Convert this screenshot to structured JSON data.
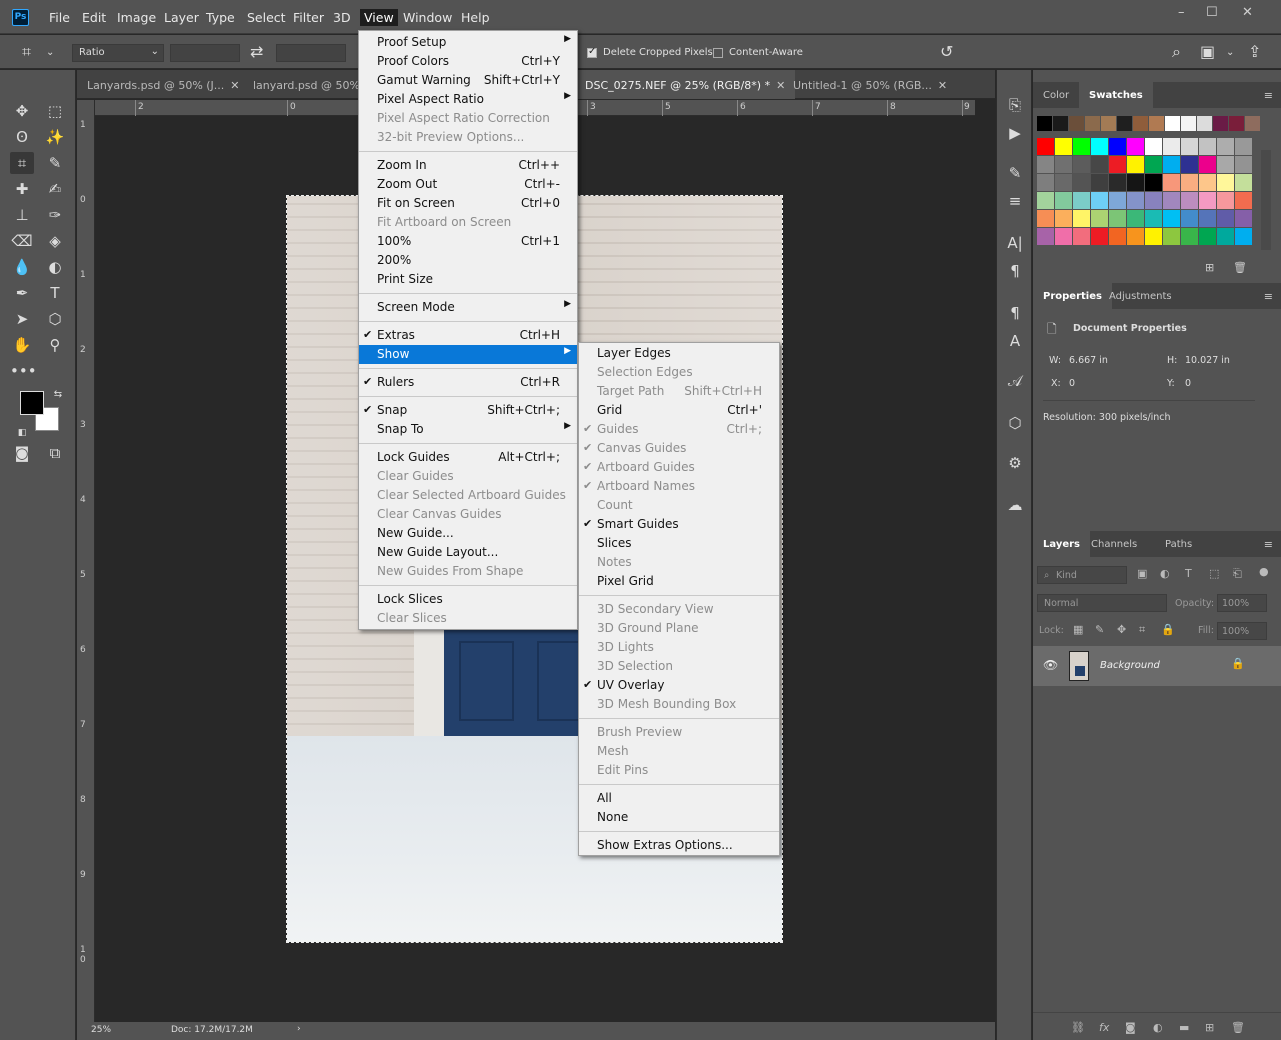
{
  "app": {
    "logo": "Ps",
    "menus": [
      "File",
      "Edit",
      "Image",
      "Layer",
      "Type",
      "Select",
      "Filter",
      "3D",
      "View",
      "Window",
      "Help"
    ],
    "window_controls": [
      "–",
      "☐",
      "✕"
    ]
  },
  "options": {
    "ratio_select": "Ratio",
    "delete_cropped": "Delete Cropped Pixels",
    "content_aware": "Content-Aware"
  },
  "tabs": [
    {
      "label": "Lanyards.psd @ 50% (J..."
    },
    {
      "label": "lanyard.psd @ 50%"
    },
    {
      "label": "DSC_0275.NEF @ 25% (RGB/8*) *"
    },
    {
      "label": "Untitled-1 @ 50% (RGB..."
    }
  ],
  "ruler_h": [
    "2",
    "0",
    "3",
    "4",
    "5",
    "6",
    "7",
    "8",
    "9"
  ],
  "ruler_v": [
    "1",
    "0",
    "1",
    "2",
    "3",
    "4",
    "5",
    "6",
    "7",
    "8",
    "9",
    "1",
    "0"
  ],
  "status": {
    "zoom": "25%",
    "doc": "Doc: 17.2M/17.2M"
  },
  "view_menu": [
    {
      "label": "Proof Setup",
      "shortcut": "",
      "arrow": true
    },
    {
      "label": "Proof Colors",
      "shortcut": "Ctrl+Y"
    },
    {
      "label": "Gamut Warning",
      "shortcut": "Shift+Ctrl+Y"
    },
    {
      "label": "Pixel Aspect Ratio",
      "shortcut": "",
      "arrow": true
    },
    {
      "label": "Pixel Aspect Ratio Correction",
      "disabled": true
    },
    {
      "label": "32-bit Preview Options...",
      "disabled": true
    },
    {
      "label": "Zoom In",
      "shortcut": "Ctrl++"
    },
    {
      "label": "Zoom Out",
      "shortcut": "Ctrl+-"
    },
    {
      "label": "Fit on Screen",
      "shortcut": "Ctrl+0"
    },
    {
      "label": "Fit Artboard on Screen",
      "disabled": true
    },
    {
      "label": "100%",
      "shortcut": "Ctrl+1"
    },
    {
      "label": "200%"
    },
    {
      "label": "Print Size"
    },
    {
      "label": "Screen Mode",
      "arrow": true
    },
    {
      "label": "Extras",
      "shortcut": "Ctrl+H",
      "checked": true
    },
    {
      "label": "Show",
      "arrow": true,
      "highlight": true
    },
    {
      "label": "Rulers",
      "shortcut": "Ctrl+R",
      "checked": true
    },
    {
      "label": "Snap",
      "shortcut": "Shift+Ctrl+;",
      "checked": true
    },
    {
      "label": "Snap To",
      "arrow": true
    },
    {
      "label": "Lock Guides",
      "shortcut": "Alt+Ctrl+;"
    },
    {
      "label": "Clear Guides",
      "disabled": true
    },
    {
      "label": "Clear Selected Artboard Guides",
      "disabled": true
    },
    {
      "label": "Clear Canvas Guides",
      "disabled": true
    },
    {
      "label": "New Guide..."
    },
    {
      "label": "New Guide Layout..."
    },
    {
      "label": "New Guides From Shape",
      "disabled": true
    },
    {
      "label": "Lock Slices"
    },
    {
      "label": "Clear Slices",
      "disabled": true
    }
  ],
  "show_menu": [
    {
      "label": "Layer Edges"
    },
    {
      "label": "Selection Edges",
      "disabled": true
    },
    {
      "label": "Target Path",
      "shortcut": "Shift+Ctrl+H",
      "disabled": true
    },
    {
      "label": "Grid",
      "shortcut": "Ctrl+'"
    },
    {
      "label": "Guides",
      "shortcut": "Ctrl+;",
      "checked": true,
      "disabled": true
    },
    {
      "label": "Canvas Guides",
      "checked": true,
      "disabled": true
    },
    {
      "label": "Artboard Guides",
      "checked": true,
      "disabled": true
    },
    {
      "label": "Artboard Names",
      "checked": true,
      "disabled": true
    },
    {
      "label": "Count",
      "disabled": true
    },
    {
      "label": "Smart Guides",
      "checked": true
    },
    {
      "label": "Slices"
    },
    {
      "label": "Notes",
      "disabled": true
    },
    {
      "label": "Pixel Grid"
    },
    {
      "label": "3D Secondary View",
      "disabled": true
    },
    {
      "label": "3D Ground Plane",
      "disabled": true
    },
    {
      "label": "3D Lights",
      "disabled": true
    },
    {
      "label": "3D Selection",
      "disabled": true
    },
    {
      "label": "UV Overlay",
      "checked": true
    },
    {
      "label": "3D Mesh Bounding Box",
      "disabled": true
    },
    {
      "label": "Brush Preview",
      "disabled": true
    },
    {
      "label": "Mesh",
      "disabled": true
    },
    {
      "label": "Edit Pins",
      "disabled": true
    },
    {
      "label": "All"
    },
    {
      "label": "None"
    },
    {
      "label": "Show Extras Options..."
    }
  ],
  "panels": {
    "color_tab": "Color",
    "swatches_tab": "Swatches",
    "properties_tab": "Properties",
    "adjustments_tab": "Adjustments",
    "doc_props": "Document Properties",
    "w_label": "W:",
    "w_value": "6.667 in",
    "h_label": "H:",
    "h_value": "10.027 in",
    "x_label": "X:",
    "x_value": "0",
    "y_label": "Y:",
    "y_value": "0",
    "resolution": "Resolution: 300 pixels/inch",
    "layers_tab": "Layers",
    "channels_tab": "Channels",
    "paths_tab": "Paths",
    "kind": "Kind",
    "blend_mode": "Normal",
    "opacity_label": "Opacity:",
    "opacity_value": "100%",
    "lock_label": "Lock:",
    "fill_label": "Fill:",
    "fill_value": "100%",
    "layer_name": "Background"
  },
  "swatch_colors": {
    "row0": [
      "#000000",
      "#1a1a1a",
      "#6b4f3a",
      "#8b6a4c",
      "#a37b55",
      "#1f1f1f",
      "#8f5d3b",
      "#b07a52",
      "#ffffff",
      "#f4f4f4",
      "#dcdcdc",
      "#6a1b46",
      "#7a1e3a",
      "#8e6c5e"
    ],
    "row1": [
      "#ff0000",
      "#ffff00",
      "#00ff00",
      "#00ffff",
      "#0000ff",
      "#ff00ff",
      "#ffffff",
      "#ebebeb",
      "#d6d6d6",
      "#c2c2c2",
      "#adadad",
      "#999999"
    ],
    "row2": [
      "#858585",
      "#707070",
      "#5c5c5c",
      "#474747",
      "#ed1c24",
      "#fff200",
      "#00a651",
      "#00aeef",
      "#2e3192",
      "#ec008c",
      "#a8a8a8",
      "#939393"
    ],
    "row3": [
      "#7e7e7e",
      "#696969",
      "#545454",
      "#3f3f3f",
      "#2a2a2a",
      "#151515",
      "#000000",
      "#f7977a",
      "#f9ad81",
      "#fdc68a",
      "#fff79a",
      "#c4df9b"
    ],
    "row4": [
      "#a3d39c",
      "#82ca9d",
      "#7bcdc8",
      "#6ecff6",
      "#7ea7d8",
      "#8493ca",
      "#8882be",
      "#a187be",
      "#bc8dbf",
      "#f49ac2",
      "#f6989d",
      "#f26c4f"
    ],
    "row5": [
      "#f68e55",
      "#fbaf5c",
      "#fff467",
      "#acd372",
      "#7cc576",
      "#3bb878",
      "#1abbb4",
      "#00bff3",
      "#438ccb",
      "#5574b9",
      "#605ca8",
      "#855fa8"
    ],
    "row6": [
      "#a763a8",
      "#f06ea9",
      "#f26d7d",
      "#ed1c24",
      "#f26522",
      "#f7941d",
      "#fff200",
      "#8dc73f",
      "#39b54a",
      "#00a651",
      "#00a99d",
      "#00aeef"
    ]
  }
}
